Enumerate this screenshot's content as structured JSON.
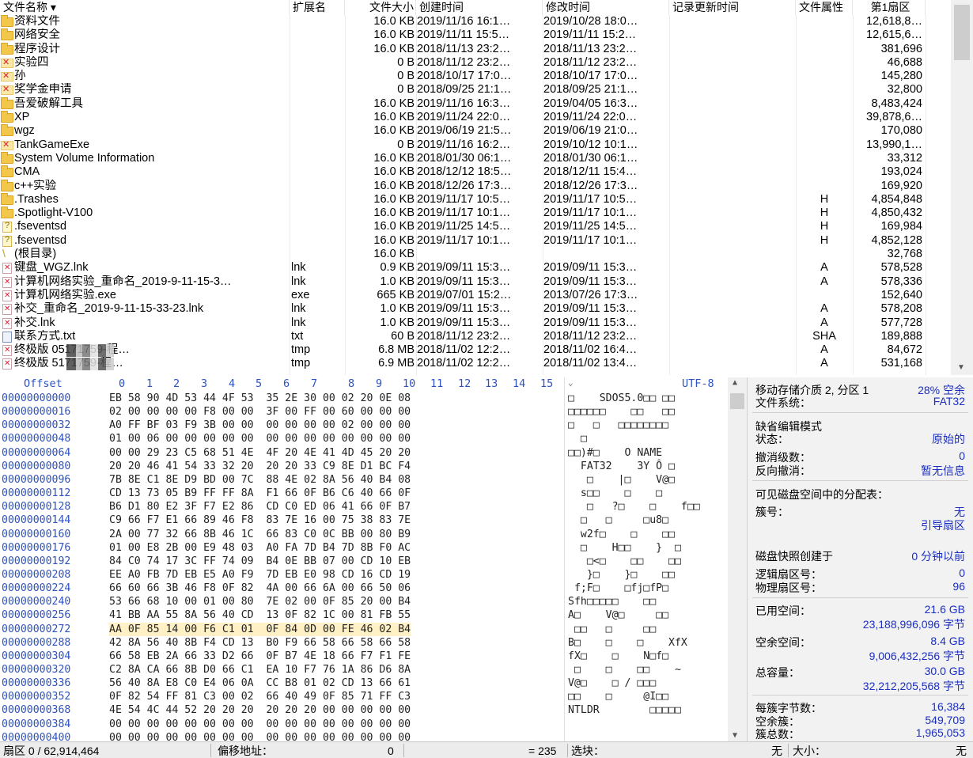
{
  "filelist": {
    "columns": {
      "name": "文件名称",
      "ext": "扩展名",
      "size": "文件大小",
      "created": "创建时间",
      "modified": "修改时间",
      "updated": "记录更新时间",
      "attr": "文件属性",
      "sector": "第1扇区"
    },
    "rows": [
      {
        "icon": "folder",
        "name": "资料文件",
        "ext": "",
        "size": "16.0 KB",
        "created": "2019/11/16  16:1…",
        "modified": "2019/10/28  18:0…",
        "attr": "",
        "sector": "12,618,8…"
      },
      {
        "icon": "folder",
        "name": "网络安全",
        "ext": "",
        "size": "16.0 KB",
        "created": "2019/11/11  15:5…",
        "modified": "2019/11/11  15:2…",
        "attr": "",
        "sector": "12,615,6…"
      },
      {
        "icon": "folder",
        "name": "程序设计",
        "ext": "",
        "size": "16.0 KB",
        "created": "2018/11/13  23:2…",
        "modified": "2018/11/13  23:2…",
        "attr": "",
        "sector": "381,696"
      },
      {
        "icon": "delfolder",
        "name": "实验四",
        "ext": "",
        "size": "0 B",
        "created": "2018/11/12  23:2…",
        "modified": "2018/11/12  23:2…",
        "attr": "",
        "sector": "46,688"
      },
      {
        "icon": "delfolder",
        "name": "孙",
        "ext": "",
        "size": "0 B",
        "created": "2018/10/17  17:0…",
        "modified": "2018/10/17  17:0…",
        "attr": "",
        "sector": "145,280"
      },
      {
        "icon": "delfolder",
        "name": "奖学金申请",
        "ext": "",
        "size": "0 B",
        "created": "2018/09/25  21:1…",
        "modified": "2018/09/25  21:1…",
        "attr": "",
        "sector": "32,800"
      },
      {
        "icon": "folder",
        "name": "吾爱破解工具",
        "ext": "",
        "size": "16.0 KB",
        "created": "2019/11/16  16:3…",
        "modified": "2019/04/05  16:3…",
        "attr": "",
        "sector": "8,483,424"
      },
      {
        "icon": "folder",
        "name": "XP",
        "ext": "",
        "size": "16.0 KB",
        "created": "2019/11/24  22:0…",
        "modified": "2019/11/24  22:0…",
        "attr": "",
        "sector": "39,878,6…"
      },
      {
        "icon": "folder",
        "name": "wgz",
        "ext": "",
        "size": "16.0 KB",
        "created": "2019/06/19  21:5…",
        "modified": "2019/06/19  21:0…",
        "attr": "",
        "sector": "170,080"
      },
      {
        "icon": "delfolder",
        "name": "TankGameExe",
        "ext": "",
        "size": "0 B",
        "created": "2019/11/16  16:2…",
        "modified": "2019/10/12  10:1…",
        "attr": "",
        "sector": "13,990,1…"
      },
      {
        "icon": "folder",
        "name": "System Volume Information",
        "ext": "",
        "size": "16.0 KB",
        "created": "2018/01/30  06:1…",
        "modified": "2018/01/30  06:1…",
        "attr": "",
        "sector": "33,312"
      },
      {
        "icon": "folder",
        "name": "CMA",
        "ext": "",
        "size": "16.0 KB",
        "created": "2018/12/12  18:5…",
        "modified": "2018/12/11  15:4…",
        "attr": "",
        "sector": "193,024"
      },
      {
        "icon": "folder",
        "name": "c++实验",
        "ext": "",
        "size": "16.0 KB",
        "created": "2018/12/26  17:3…",
        "modified": "2018/12/26  17:3…",
        "attr": "",
        "sector": "169,920"
      },
      {
        "icon": "folder",
        "name": ".Trashes",
        "ext": "",
        "size": "16.0 KB",
        "created": "2019/11/17  10:5…",
        "modified": "2019/11/17  10:5…",
        "attr": "H",
        "sector": "4,854,848"
      },
      {
        "icon": "folder",
        "name": ".Spotlight-V100",
        "ext": "",
        "size": "16.0 KB",
        "created": "2019/11/17  10:1…",
        "modified": "2019/11/17  10:1…",
        "attr": "H",
        "sector": "4,850,432"
      },
      {
        "icon": "q",
        "name": ".fseventsd",
        "ext": "",
        "size": "16.0 KB",
        "created": "2019/11/25  14:5…",
        "modified": "2019/11/25  14:5…",
        "attr": "H",
        "sector": "169,984"
      },
      {
        "icon": "q",
        "name": ".fseventsd",
        "ext": "",
        "size": "16.0 KB",
        "created": "2019/11/17  10:1…",
        "modified": "2019/11/17  10:1…",
        "attr": "H",
        "sector": "4,852,128"
      },
      {
        "icon": "root",
        "name": "(根目录)",
        "ext": "",
        "size": "16.0 KB",
        "created": "",
        "modified": "",
        "attr": "",
        "sector": "32,768"
      },
      {
        "icon": "delfile",
        "name": "键盘_WGZ.lnk",
        "ext": "lnk",
        "size": "0.9 KB",
        "created": "2019/09/11  15:3…",
        "modified": "2019/09/11  15:3…",
        "attr": "A",
        "sector": "578,528"
      },
      {
        "icon": "delfile",
        "name": "计算机网络实验_重命名_2019-9-11-15-3…",
        "ext": "lnk",
        "size": "1.0 KB",
        "created": "2019/09/11  15:3…",
        "modified": "2019/09/11  15:3…",
        "attr": "A",
        "sector": "578,336"
      },
      {
        "icon": "delfile",
        "name": "计算机网络实验.exe",
        "ext": "exe",
        "size": "665 KB",
        "created": "2019/07/01  15:2…",
        "modified": "2013/07/26  17:3…",
        "attr": "",
        "sector": "152,640"
      },
      {
        "icon": "delfile",
        "name": "补交_重命名_2019-9-11-15-33-23.lnk",
        "ext": "lnk",
        "size": "1.0 KB",
        "created": "2019/09/11  15:3…",
        "modified": "2019/09/11  15:3…",
        "attr": "A",
        "sector": "578,208"
      },
      {
        "icon": "delfile",
        "name": "补交.lnk",
        "ext": "lnk",
        "size": "1.0 KB",
        "created": "2019/09/11  15:3…",
        "modified": "2019/09/11  15:3…",
        "attr": "A",
        "sector": "577,728"
      },
      {
        "icon": "txt",
        "name": "联系方式.txt",
        "ext": "txt",
        "size": "60 B",
        "created": "2018/11/12  23:2…",
        "modified": "2018/11/12  23:2…",
        "attr": "SHA",
        "sector": "189,888"
      },
      {
        "icon": "delfile",
        "name": "终极版          05171759-程…",
        "ext": "tmp",
        "size": "6.8 MB",
        "created": "2018/11/02  12:2…",
        "modified": "2018/11/02  16:4…",
        "attr": "A",
        "sector": "84,672",
        "blurred": true
      },
      {
        "icon": "delfile",
        "name": "终极版          5171759-程…",
        "ext": "tmp",
        "size": "6.9 MB",
        "created": "2018/11/02  12:2…",
        "modified": "2018/11/02  13:4…",
        "attr": "A",
        "sector": "531,168",
        "blurred": true
      }
    ]
  },
  "hex": {
    "offset_label": "Offset",
    "col_labels": [
      "0",
      "1",
      "2",
      "3",
      "4",
      "5",
      "6",
      "7",
      "8",
      "9",
      "10",
      "11",
      "12",
      "13",
      "14",
      "15"
    ],
    "encoding": "UTF-8",
    "rows": [
      {
        "off": "00000000000",
        "bytes": "EB 58 90 4D 53 44 4F 53  35 2E 30 00 02 20 0E 08",
        "ascii": "□    SDOS5.0□□ □□"
      },
      {
        "off": "00000000016",
        "bytes": "02 00 00 00 00 F8 00 00  3F 00 FF 00 60 00 00 00",
        "ascii": "□□□□□□    □□   □□"
      },
      {
        "off": "00000000032",
        "bytes": "A0 FF BF 03 F9 3B 00 00  00 00 00 00 02 00 00 00",
        "ascii": "□   □   □□□□□□□□"
      },
      {
        "off": "00000000048",
        "bytes": "01 00 06 00 00 00 00 00  00 00 00 00 00 00 00 00",
        "ascii": "  □"
      },
      {
        "off": "00000000064",
        "bytes": "00 00 29 23 C5 68 51 4E  4F 20 4E 41 4D 45 20 20",
        "ascii": "□□)#□    O NAME"
      },
      {
        "off": "00000000080",
        "bytes": "20 20 46 41 54 33 32 20  20 20 33 C9 8E D1 BC F4",
        "ascii": "  FAT32    3Y Ô □"
      },
      {
        "off": "00000000096",
        "bytes": "7B 8E C1 8E D9 BD 00 7C  88 4E 02 8A 56 40 B4 08",
        "ascii": "   □    |□    V@□"
      },
      {
        "off": "00000000112",
        "bytes": "CD 13 73 05 B9 FF FF 8A  F1 66 0F B6 C6 40 66 0F",
        "ascii": "  s□□    □    □"
      },
      {
        "off": "00000000128",
        "bytes": "B6 D1 80 E2 3F F7 E2 86  CD C0 ED 06 41 66 0F B7",
        "ascii": "   □   ?□    □    f□□"
      },
      {
        "off": "00000000144",
        "bytes": "C9 66 F7 E1 66 89 46 F8  83 7E 16 00 75 38 83 7E",
        "ascii": "  □   □     □u8□"
      },
      {
        "off": "00000000160",
        "bytes": "2A 00 77 32 66 8B 46 1C  66 83 C0 0C BB 00 80 B9",
        "ascii": "  w2f□    □    □□"
      },
      {
        "off": "00000000176",
        "bytes": "01 00 E8 2B 00 E9 48 03  A0 FA 7D B4 7D 8B F0 AC",
        "ascii": "  □    H□□    }  □"
      },
      {
        "off": "00000000192",
        "bytes": "84 C0 74 17 3C FF 74 09  B4 0E BB 07 00 CD 10 EB",
        "ascii": "   □<□    □□    □□"
      },
      {
        "off": "00000000208",
        "bytes": "EE A0 FB 7D EB E5 A0 F9  7D EB E0 98 CD 16 CD 19",
        "ascii": "   }□    }□    □□"
      },
      {
        "off": "00000000224",
        "bytes": "66 60 66 3B 46 F8 0F 82  4A 00 66 6A 00 66 50 06",
        "ascii": " f;F□    □fj□fP□"
      },
      {
        "off": "00000000240",
        "bytes": "53 66 68 10 00 01 00 80  7E 02 00 0F 85 20 00 B4",
        "ascii": "Sfh□□□□□    □□"
      },
      {
        "off": "00000000256",
        "bytes": "41 BB AA 55 8A 56 40 CD  13 0F 82 1C 00 81 FB 55",
        "ascii": "A□    V@□     □□"
      },
      {
        "off": "00000000272",
        "bytes": "AA 0F 85 14 00 F6 C1 01  0F 84 0D 00 FE 46 02 B4",
        "ascii": " □□   □     □□"
      },
      {
        "off": "00000000288",
        "bytes": "42 8A 56 40 8B F4 CD 13  B0 F9 66 58 66 58 66 58",
        "ascii": "B□    □    □    XfX"
      },
      {
        "off": "00000000304",
        "bytes": "66 58 EB 2A 66 33 D2 66  0F B7 4E 18 66 F7 F1 FE",
        "ascii": "fX□    □    N□f□"
      },
      {
        "off": "00000000320",
        "bytes": "C2 8A CA 66 8B D0 66 C1  EA 10 F7 76 1A 86 D6 8A",
        "ascii": " □    □    □□    ~"
      },
      {
        "off": "00000000336",
        "bytes": "56 40 8A E8 C0 E4 06 0A  CC B8 01 02 CD 13 66 61",
        "ascii": "V@□    □ / □□□"
      },
      {
        "off": "00000000352",
        "bytes": "0F 82 54 FF 81 C3 00 02  66 40 49 0F 85 71 FF C3",
        "ascii": "□□    □     @I□□"
      },
      {
        "off": "00000000368",
        "bytes": "4E 54 4C 44 52 20 20 20  20 20 20 00 00 00 00 00",
        "ascii": "NTLDR        □□□□□"
      },
      {
        "off": "00000000384",
        "bytes": "00 00 00 00 00 00 00 00  00 00 00 00 00 00 00 00",
        "ascii": ""
      },
      {
        "off": "00000000400",
        "bytes": "00 00 00 00 00 00 00 00  00 00 00 00 00 00 00 00",
        "ascii": ""
      }
    ]
  },
  "info": {
    "media": "移动存储介质 2, 分区 1",
    "free_pct": "28% 空余",
    "fs_label": "文件系统：",
    "fs": "FAT32",
    "edit_mode_title": "缺省编辑模式",
    "state_label": "状态：",
    "state": "原始的",
    "undo_label": "撤消级数：",
    "undo": "0",
    "redo_label": "反向撤消：",
    "redo": "暂无信息",
    "alloc_title": "可见磁盘空间中的分配表：",
    "cluster_label": "簇号：",
    "cluster": "无",
    "cluster_sub": "引导扇区",
    "snapshot_label": "磁盘快照创建于",
    "snapshot": "0 分钟以前",
    "logical_label": "逻辑扇区号：",
    "logical": "0",
    "physical_label": "物理扇区号：",
    "physical": "96",
    "used_label": "已用空间：",
    "used": "21.6 GB",
    "used_bytes": "23,188,996,096 字节",
    "free_label": "空余空间：",
    "free": "8.4 GB",
    "free_bytes": "9,006,432,256 字节",
    "total_label": "总容量：",
    "total": "30.0 GB",
    "total_bytes": "32,212,205,568 字节",
    "bpc_label": "每簇字节数：",
    "bpc": "16,384",
    "free_clusters_label": "空余簇：",
    "free_clusters": "549,709",
    "total_clusters_label": "簇总数：",
    "total_clusters": "1,965,053"
  },
  "status": {
    "sector": "扇区 0 / 62,914,464",
    "offset_label": "偏移地址：",
    "offset_value": "0",
    "eq_value": "= 235",
    "block_label": "选块：",
    "block_value": "无",
    "size_label": "大小：",
    "size_value": "无"
  }
}
